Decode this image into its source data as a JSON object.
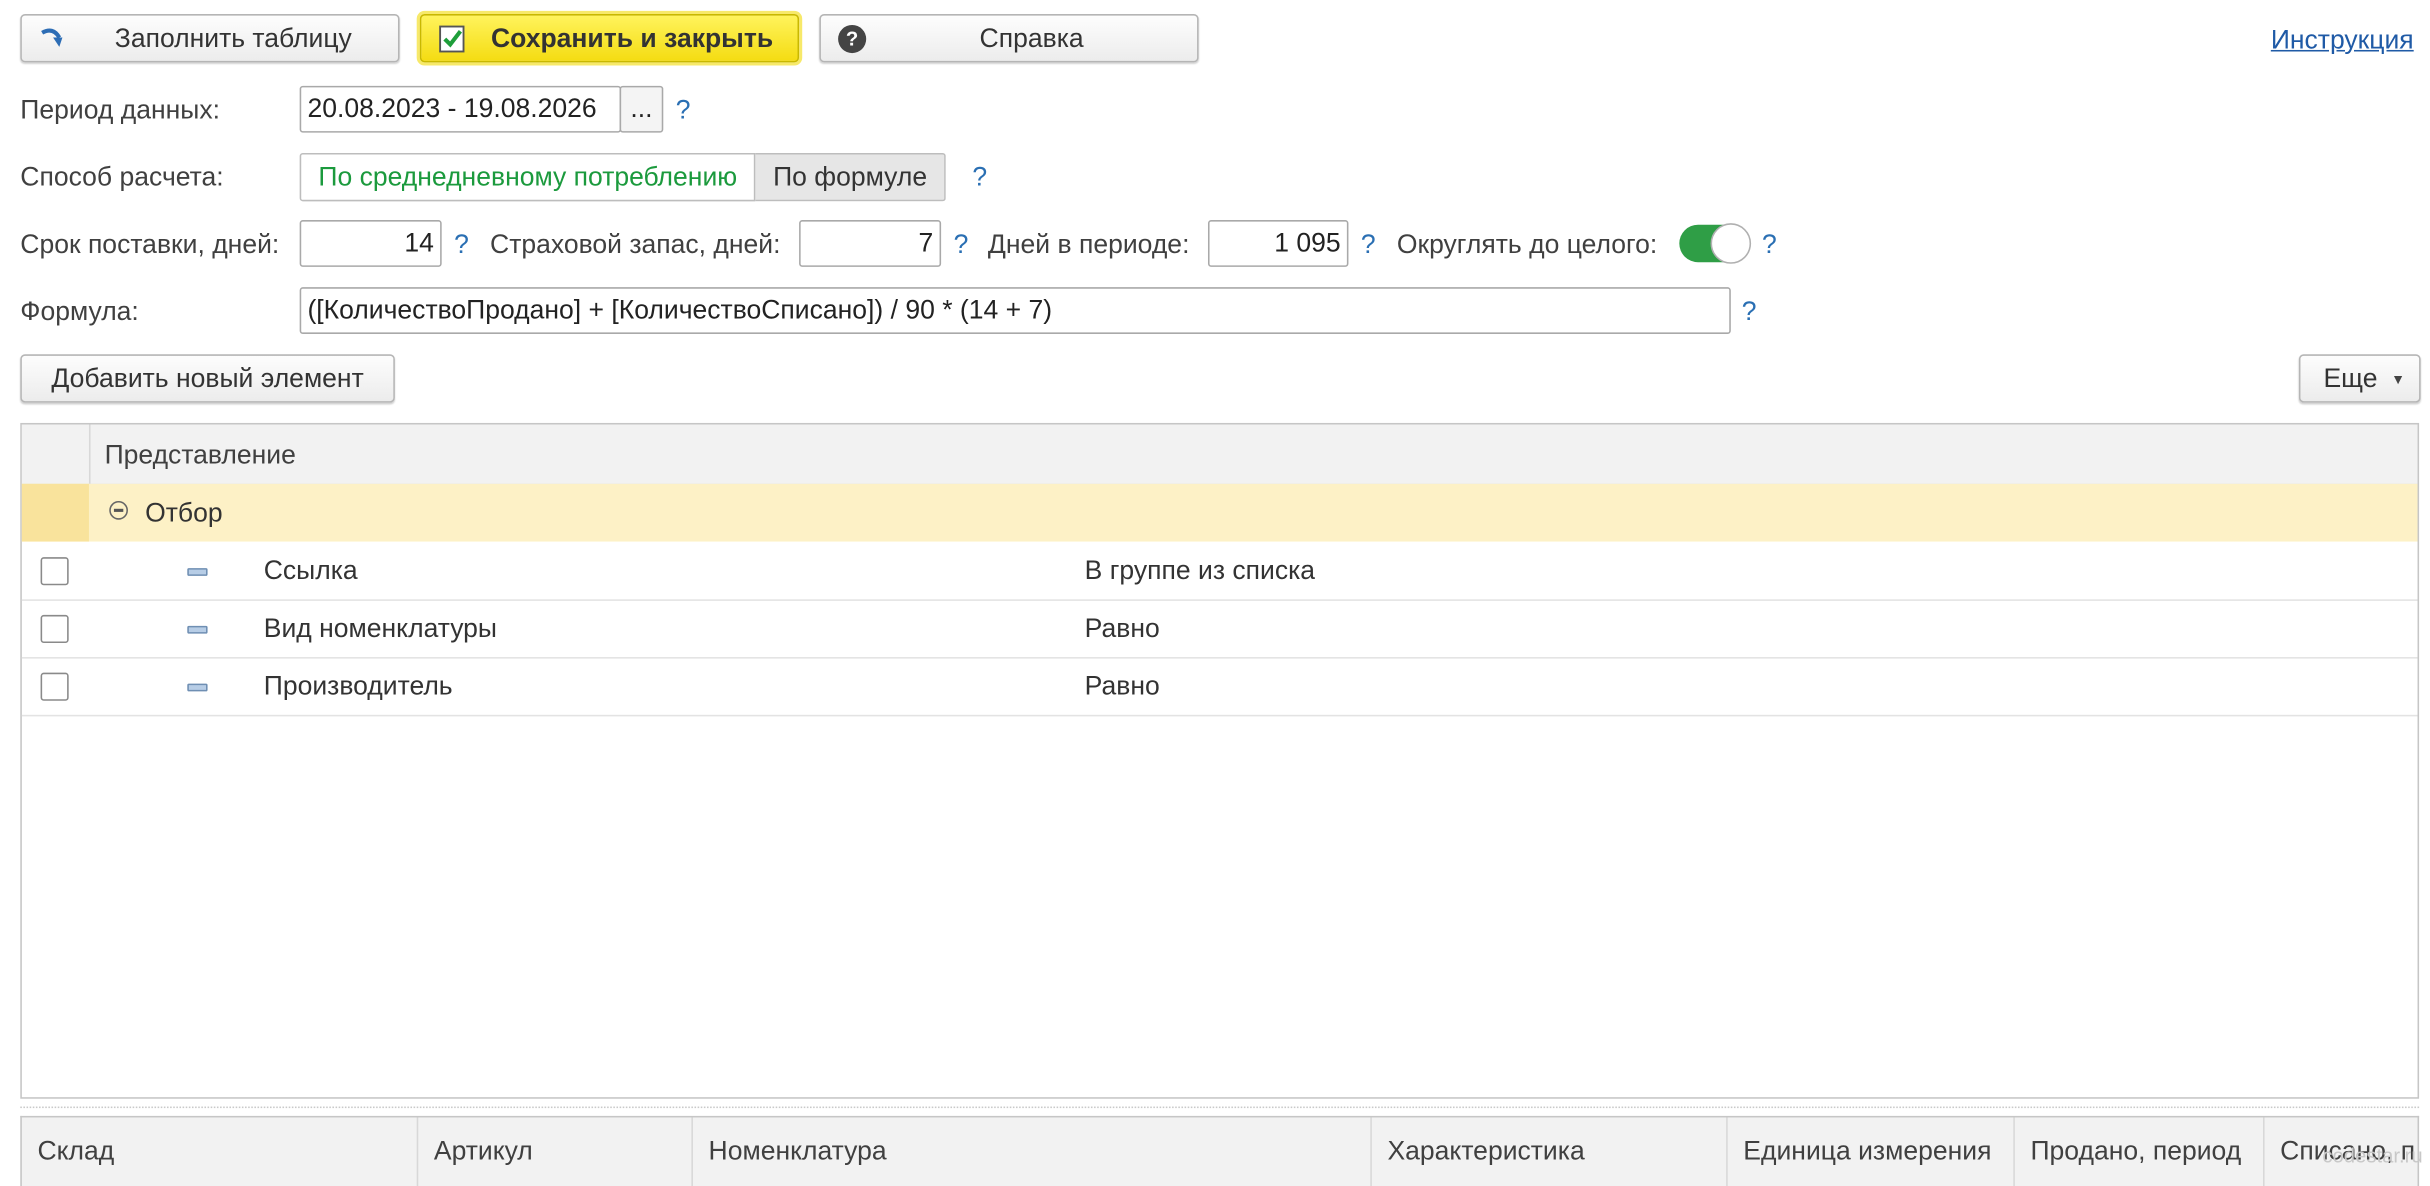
{
  "toolbar": {
    "fill_table_label": "Заполнить таблицу",
    "save_close_label": "Сохранить и закрыть",
    "help_label": "Справка",
    "instruction_link": "Инструкция"
  },
  "period": {
    "label": "Период данных:",
    "value": "20.08.2023 - 19.08.2026",
    "select_button": "...",
    "hint": "?"
  },
  "calc_method": {
    "label": "Способ расчета:",
    "options": [
      "По среднедневному потреблению",
      "По формуле"
    ],
    "selected": "По среднедневному потреблению",
    "hint": "?"
  },
  "params": {
    "lead_time_label": "Срок поставки, дней:",
    "lead_time_value": "14",
    "safety_stock_label": "Страховой запас, дней:",
    "safety_stock_value": "7",
    "days_in_period_label": "Дней в периоде:",
    "days_in_period_value": "1 095",
    "round_label": "Округлять до целого:",
    "round_enabled": true,
    "hint": "?"
  },
  "formula": {
    "label": "Формула:",
    "value": "([КоличествоПродано] + [КоличествоСписано]) / 90 * (14 + 7)",
    "hint": "?"
  },
  "filter_toolbar": {
    "add_label": "Добавить новый элемент",
    "more_label": "Еще"
  },
  "filter_table": {
    "header": "Представление",
    "group_label": "Отбор",
    "rows": [
      {
        "field": "Ссылка",
        "condition": "В группе из списка"
      },
      {
        "field": "Вид номенклатуры",
        "condition": "Равно"
      },
      {
        "field": "Производитель",
        "condition": "Равно"
      }
    ]
  },
  "main_table": {
    "columns": [
      "Склад",
      "Артикул",
      "Номенклатура",
      "Характеристика",
      "Единица измерения",
      "Продано, период",
      "Списано, п"
    ]
  },
  "watermark": "codestar.ru",
  "colors": {
    "accent_yellow": "#f4dc12",
    "selected_option_green": "#1b9a3d",
    "toggle_green": "#2f9e46",
    "link_blue": "#1f5aa6",
    "group_row_bg": "#fdf1c6"
  }
}
